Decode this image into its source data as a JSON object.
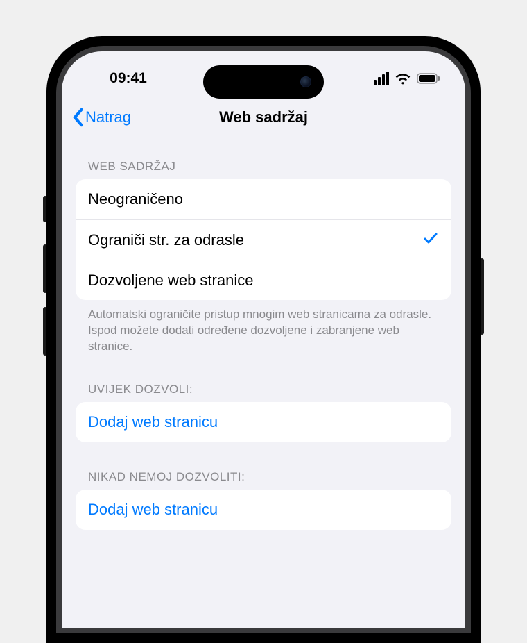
{
  "statusbar": {
    "time": "09:41"
  },
  "nav": {
    "back": "Natrag",
    "title": "Web sadržaj"
  },
  "sections": {
    "web": {
      "header": "WEB SADRŽAJ",
      "options": [
        {
          "label": "Neograničeno",
          "selected": false
        },
        {
          "label": "Ograniči str. za odrasle",
          "selected": true
        },
        {
          "label": "Dozvoljene web stranice",
          "selected": false
        }
      ],
      "footer": "Automatski ograničite pristup mnogim web stranicama za odrasle. Ispod možete dodati određene dozvoljene i zabranjene web stranice."
    },
    "allow": {
      "header": "UVIJEK DOZVOLI:",
      "add_label": "Dodaj web stranicu"
    },
    "never": {
      "header": "NIKAD NEMOJ DOZVOLITI:",
      "add_label": "Dodaj web stranicu"
    }
  },
  "colors": {
    "accent": "#007aff",
    "bg": "#f2f2f7"
  }
}
